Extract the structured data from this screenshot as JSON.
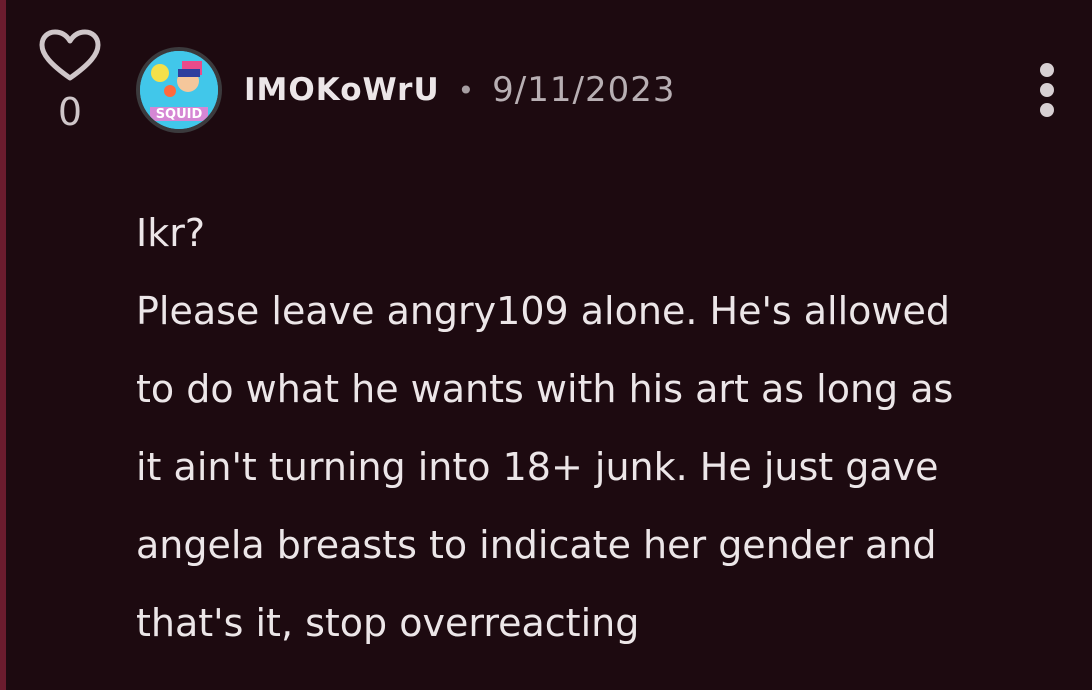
{
  "comment": {
    "vote_count": "0",
    "author": {
      "username": "IMOKoWrU",
      "avatar_text": "SQUID"
    },
    "separator": "•",
    "date": "9/11/2023",
    "body_lines": [
      "Ikr?",
      "Please leave angry109 alone. He's allowed",
      "to do what he wants with his art as long as",
      "it ain't turning into 18+ junk. He just gave",
      "angela breasts to indicate her gender and",
      "that's it, stop overreacting"
    ]
  },
  "icons": {
    "like": "heart-icon",
    "more": "more-vertical-icon"
  },
  "colors": {
    "background": "#1d0a10",
    "thread_line": "#6b1c2e",
    "text": "#ece6e8",
    "muted_text": "#b8afb3"
  }
}
